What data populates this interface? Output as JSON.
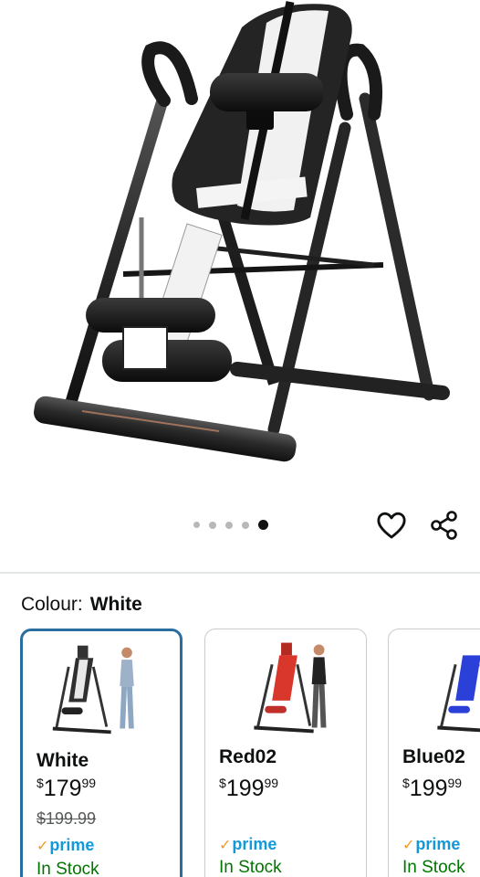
{
  "gallery": {
    "image_alt": "Inversion table",
    "dots": [
      false,
      false,
      false,
      false,
      true
    ]
  },
  "actions": {
    "wishlist": "heart-icon",
    "share": "share-icon"
  },
  "colour": {
    "label": "Colour:",
    "selected": "White"
  },
  "variants": [
    {
      "name": "White",
      "symbol": "$",
      "price_whole": "179",
      "price_cents": "99",
      "was_price": "$199.99",
      "prime": "prime",
      "stock": "In Stock",
      "accent": "#2f2f2f"
    },
    {
      "name": "Red02",
      "symbol": "$",
      "price_whole": "199",
      "price_cents": "99",
      "was_price": "",
      "prime": "prime",
      "stock": "In Stock",
      "accent": "#d9372b"
    },
    {
      "name": "Blue02",
      "symbol": "$",
      "price_whole": "199",
      "price_cents": "99",
      "was_price": "",
      "prime": "prime",
      "stock": "In Stock",
      "accent": "#2b3fd9"
    }
  ]
}
